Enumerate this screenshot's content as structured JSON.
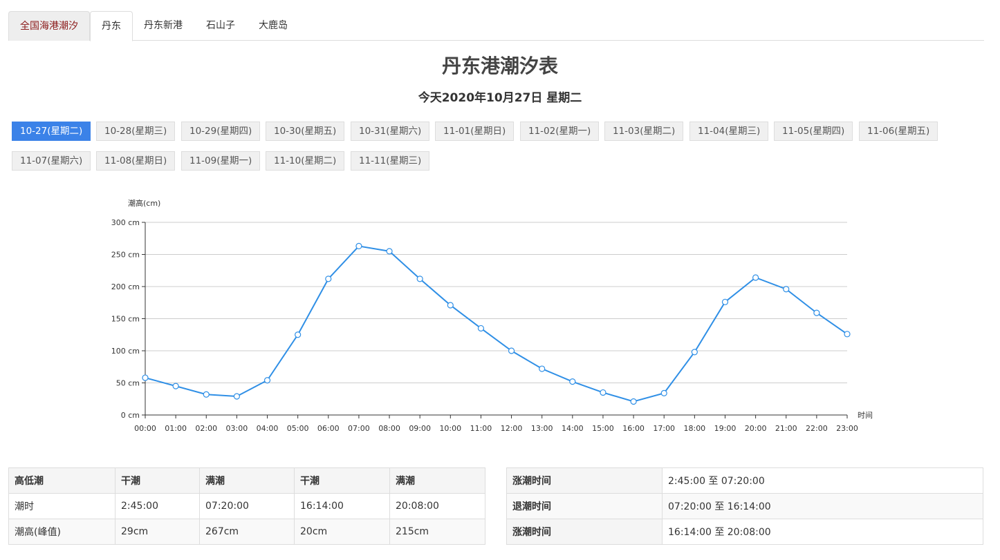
{
  "tabs": [
    "全国海港潮汐",
    "丹东",
    "丹东新港",
    "石山子",
    "大鹿岛"
  ],
  "title": "丹东港潮汐表",
  "today": "今天2020年10月27日 星期二",
  "dates": [
    "10-27(星期二)",
    "10-28(星期三)",
    "10-29(星期四)",
    "10-30(星期五)",
    "10-31(星期六)",
    "11-01(星期日)",
    "11-02(星期一)",
    "11-03(星期二)",
    "11-04(星期三)",
    "11-05(星期四)",
    "11-06(星期五)",
    "11-07(星期六)",
    "11-08(星期日)",
    "11-09(星期一)",
    "11-10(星期二)",
    "11-11(星期三)"
  ],
  "chart_data": {
    "type": "line",
    "ylabel": "潮高(cm)",
    "xlabel": "时间",
    "categories": [
      "00:00",
      "01:00",
      "02:00",
      "03:00",
      "04:00",
      "05:00",
      "06:00",
      "07:00",
      "08:00",
      "09:00",
      "10:00",
      "11:00",
      "12:00",
      "13:00",
      "14:00",
      "15:00",
      "16:00",
      "17:00",
      "18:00",
      "19:00",
      "20:00",
      "21:00",
      "22:00",
      "23:00"
    ],
    "values": [
      58,
      45,
      32,
      29,
      54,
      125,
      212,
      263,
      255,
      212,
      171,
      135,
      100,
      72,
      52,
      35,
      21,
      34,
      98,
      176,
      214,
      196,
      159,
      126
    ],
    "ylim": [
      0,
      300
    ],
    "yticks": [
      "0 cm",
      "50 cm",
      "100 cm",
      "150 cm",
      "200 cm",
      "250 cm",
      "300 cm"
    ],
    "grid": true,
    "line_color": "#2f8fe6"
  },
  "tide_table": {
    "header": [
      "高低潮",
      "干潮",
      "满潮",
      "干潮",
      "满潮"
    ],
    "rows": [
      [
        "潮时",
        "2:45:00",
        "07:20:00",
        "16:14:00",
        "20:08:00"
      ],
      [
        "潮高(峰值)",
        "29cm",
        "267cm",
        "20cm",
        "215cm"
      ]
    ]
  },
  "period_table": [
    [
      "涨潮时间",
      "2:45:00 至 07:20:00"
    ],
    [
      "退潮时间",
      "07:20:00 至 16:14:00"
    ],
    [
      "涨潮时间",
      "16:14:00 至 20:08:00"
    ]
  ]
}
